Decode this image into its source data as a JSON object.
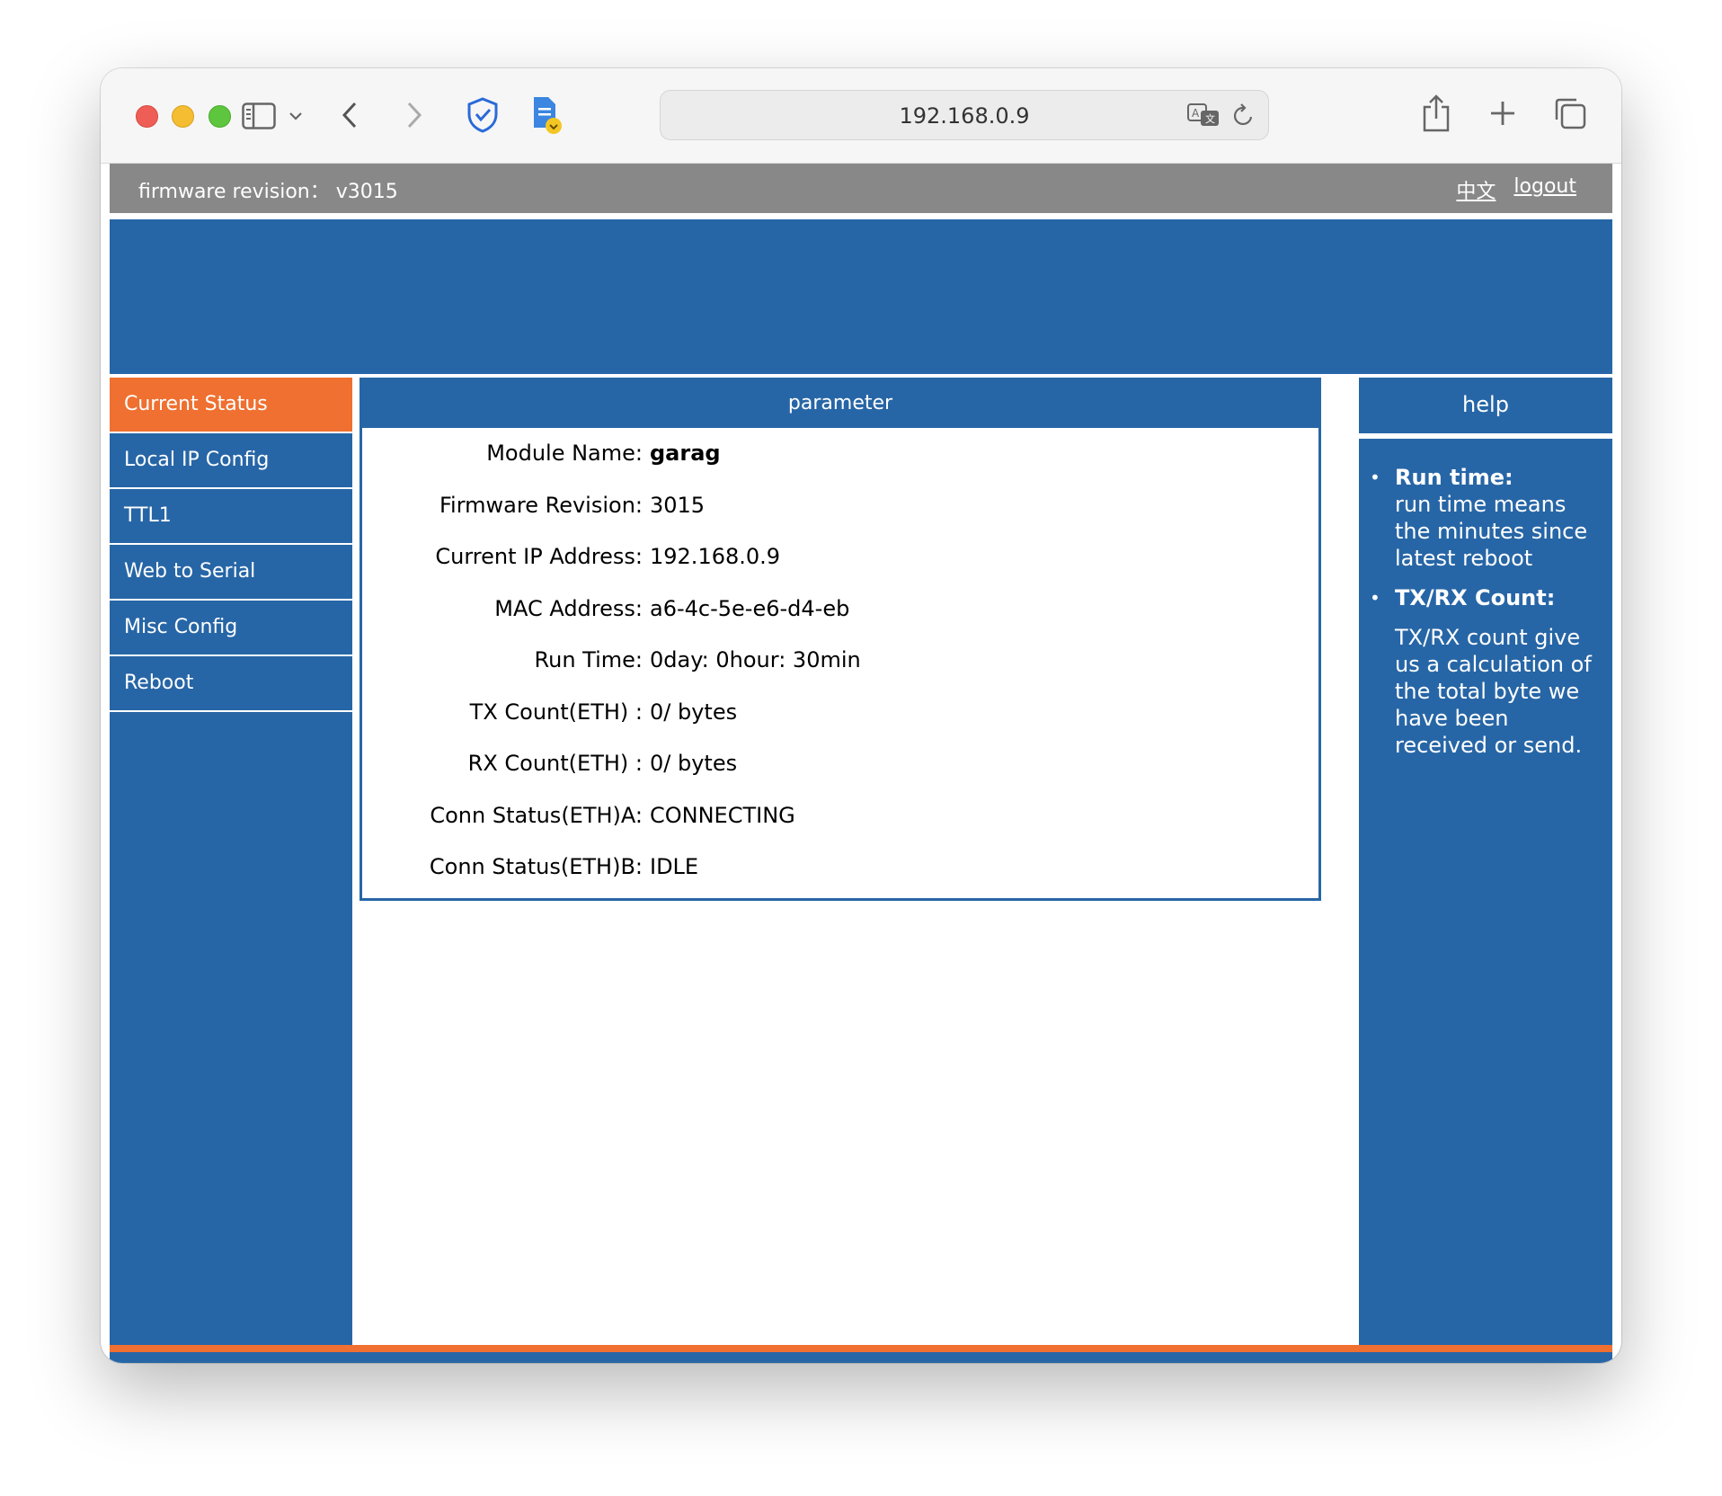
{
  "browser": {
    "url": "192.168.0.9"
  },
  "topbar": {
    "firmware": "firmware revision： v3015",
    "lang_link": "中文",
    "logout_link": "logout"
  },
  "sidebar": {
    "items": [
      {
        "label": "Current Status"
      },
      {
        "label": "Local IP Config"
      },
      {
        "label": "TTL1"
      },
      {
        "label": "Web to Serial"
      },
      {
        "label": "Misc Config"
      },
      {
        "label": "Reboot"
      }
    ]
  },
  "main": {
    "title": "parameter",
    "rows": [
      {
        "label": "Module Name:",
        "value": "garag"
      },
      {
        "label": "Firmware Revision:",
        "value": "3015"
      },
      {
        "label": "Current IP Address:",
        "value": "192.168.0.9"
      },
      {
        "label": "MAC Address:",
        "value": "a6-4c-5e-e6-d4-eb"
      },
      {
        "label": "Run Time:",
        "value": "0day: 0hour: 30min"
      },
      {
        "label": "TX Count(ETH) :",
        "value": "0/ bytes"
      },
      {
        "label": "RX Count(ETH) :",
        "value": "0/ bytes"
      },
      {
        "label": "Conn Status(ETH)A:",
        "value": "CONNECTING"
      },
      {
        "label": "Conn Status(ETH)B:",
        "value": "IDLE"
      }
    ]
  },
  "help": {
    "title": "help",
    "items": [
      {
        "term": "Run time:",
        "desc": "run time means the minutes since latest reboot"
      },
      {
        "term": "TX/RX Count:",
        "desc": "TX/RX count give us a calculation of the total byte we have been received or send."
      }
    ]
  },
  "colors": {
    "primary": "#2766a6",
    "accent": "#ef7030",
    "topbar": "#888888"
  },
  "icons": {
    "toolbar": [
      "sidebar-icon",
      "chevron-down-icon",
      "back-icon",
      "forward-icon",
      "shield-icon",
      "document-icon",
      "translate-icon",
      "reload-icon",
      "share-icon",
      "new-tab-icon",
      "tabs-icon"
    ]
  }
}
